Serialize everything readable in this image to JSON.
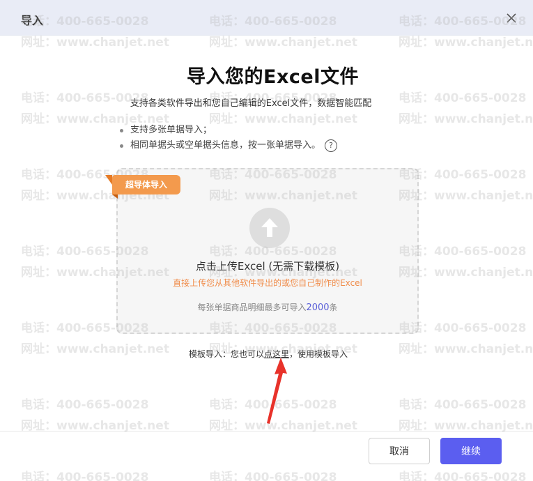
{
  "window": {
    "title": "导入"
  },
  "watermark": {
    "phone": "电话：400-665-0028",
    "website": "网址：www.chanjet.net"
  },
  "main": {
    "heading": "导入您的Excel文件",
    "subtitle": "支持各类软件导出和您自己编辑的Excel文件，数据智能匹配",
    "bullets": [
      "支持多张单据导入；",
      "相同单据头或空单据头信息，按一张单据导入。"
    ],
    "help_glyph": "?"
  },
  "badge": {
    "label": "超导体导入",
    "color": "#f39a4d"
  },
  "upload": {
    "icon": "upload-arrow-icon",
    "primary": "点击上传Excel (无需下载模板)",
    "secondary": "直接上传您从其他软件导出的或您自己制作的Excel",
    "limit_prefix": "每张单据商品明细最多可导入",
    "limit_number": "2000",
    "limit_suffix": "条"
  },
  "template": {
    "prefix": "模板导入：您也可以",
    "link": "点这里",
    "suffix": "，使用模板导入"
  },
  "annotation": {
    "arrow_color": "#e8322a"
  },
  "footer": {
    "cancel_label": "取消",
    "continue_label": "继续",
    "accent": "#5b5ef0"
  }
}
